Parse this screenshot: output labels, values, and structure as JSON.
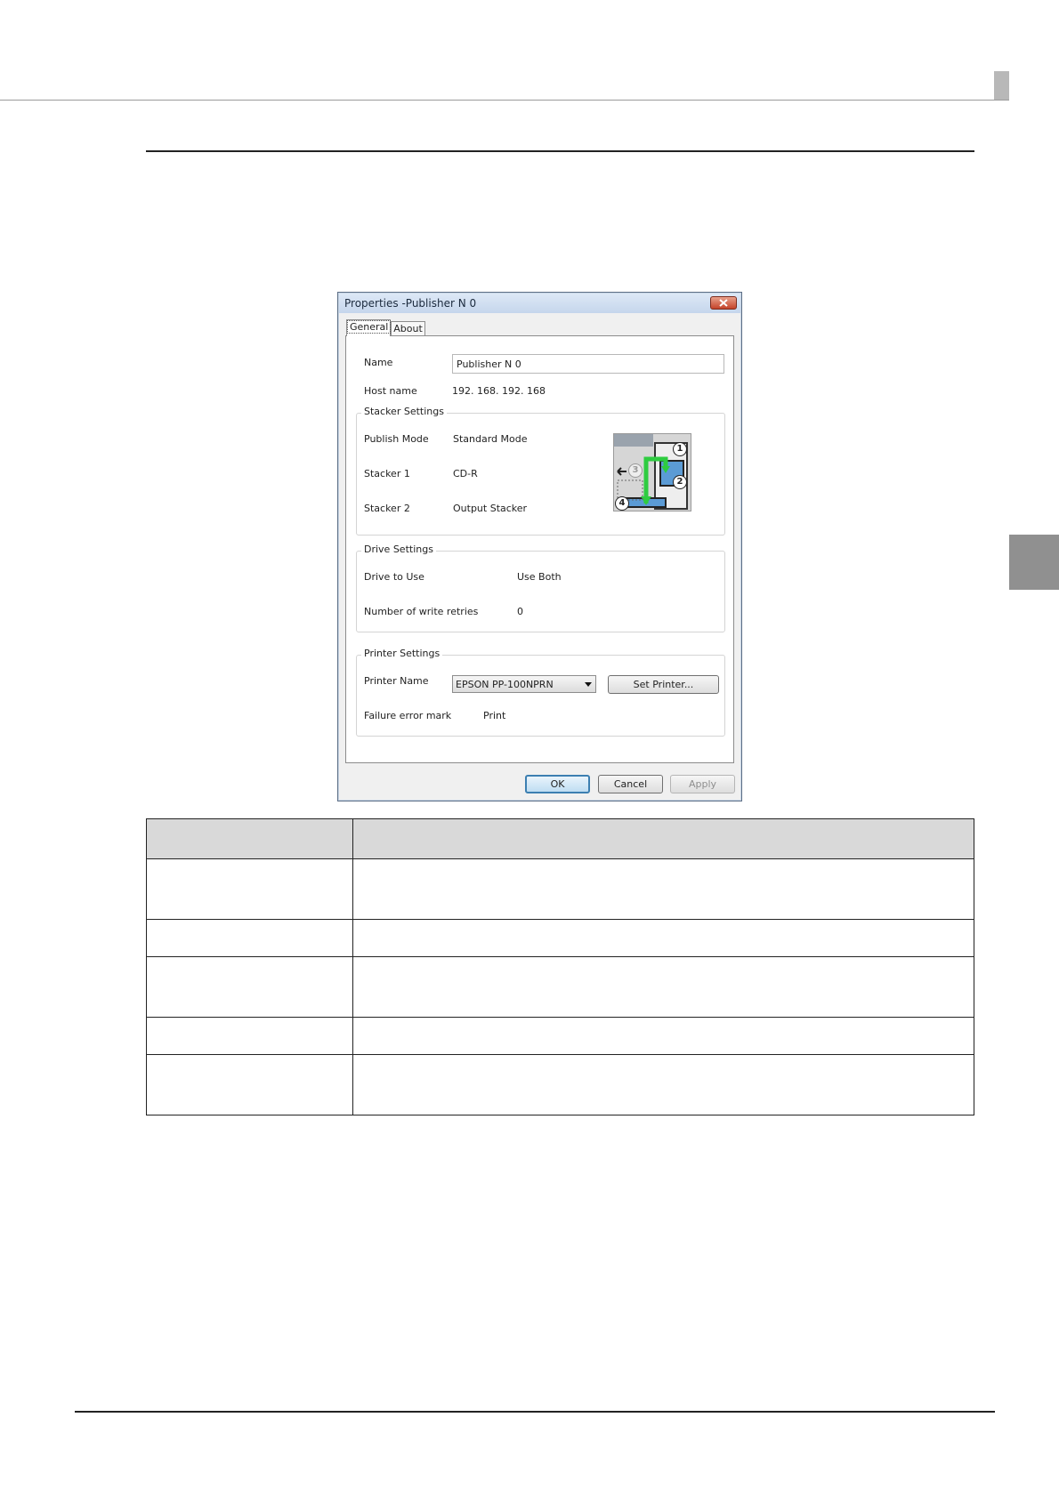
{
  "dialog": {
    "title": "Properties  -Publisher N 0",
    "tabs": [
      {
        "label": "General",
        "selected": true
      },
      {
        "label": "About",
        "selected": false
      }
    ],
    "name_label": "Name",
    "name_value": "Publisher N 0",
    "host_label": "Host name",
    "host_value": "192. 168. 192. 168",
    "stacker": {
      "title": "Stacker Settings",
      "publish_mode_label": "Publish Mode",
      "publish_mode_value": "Standard Mode",
      "stacker1_label": "Stacker 1",
      "stacker1_value": "CD-R",
      "stacker2_label": "Stacker 2",
      "stacker2_value": "Output Stacker",
      "diagram_numbers": [
        "1",
        "2",
        "3",
        "4"
      ]
    },
    "drive": {
      "title": "Drive Settings",
      "drive_label": "Drive to Use",
      "drive_value": "Use Both",
      "retries_label": "Number of write retries",
      "retries_value": "0"
    },
    "printer": {
      "title": "Printer Settings",
      "name_label": "Printer Name",
      "name_value": "EPSON PP-100NPRN",
      "set_button": "Set Printer...",
      "failure_label": "Failure error mark",
      "failure_value": "Print"
    },
    "buttons": {
      "ok": "OK",
      "cancel": "Cancel",
      "apply": "Apply"
    }
  },
  "colors": {
    "accent_green": "#2ecc40",
    "stacker_blue": "#5b9bd5",
    "header_gray": "#d9d9d9"
  }
}
